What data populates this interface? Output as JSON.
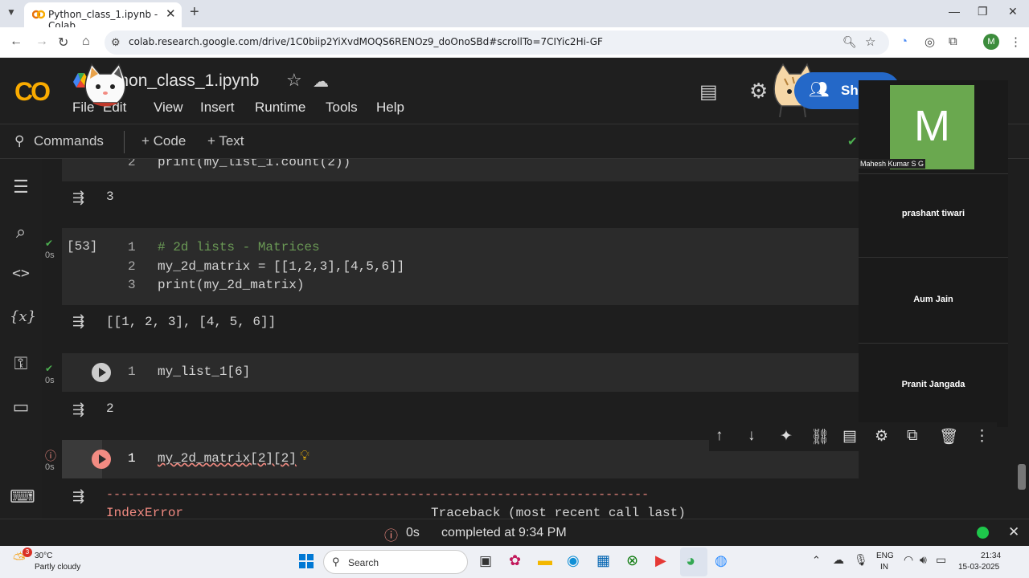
{
  "browser": {
    "tab_title": "Python_class_1.ipynb - Colab",
    "url": "colab.research.google.com/drive/1C0biip2YiXvdMOQS6RENOz9_doOnoSBd#scrollTo=7CIYic2Hi-GF",
    "profile_initial": "M"
  },
  "colab": {
    "logo": "CO",
    "notebook_title": "Python_class_1.ipynb",
    "menu": [
      "File",
      "Edit",
      "View",
      "Insert",
      "Runtime",
      "Tools",
      "Help"
    ],
    "share_label": "Sh",
    "commands_label": "Commands",
    "add_code_label": "+ Code",
    "add_text_label": "+ Text"
  },
  "cells": {
    "c1": {
      "line_no": "2",
      "code": "print(my_list_1.count(2))",
      "output": "3"
    },
    "c2": {
      "exec_count": "[53]",
      "status_time": "0s",
      "lines": [
        {
          "no": "1",
          "code": "# 2d lists - Matrices"
        },
        {
          "no": "2",
          "code": "my_2d_matrix = [[1,2,3],[4,5,6]]"
        },
        {
          "no": "3",
          "code": "print(my_2d_matrix)"
        }
      ],
      "output": "[[1, 2, 3], [4, 5, 6]]"
    },
    "c3": {
      "status_time": "0s",
      "line_no": "1",
      "code": "my_list_1[6]",
      "output": "2"
    },
    "c4": {
      "status_time": "0s",
      "line_no": "1",
      "code": "my_2d_matrix[2][2]",
      "dashes": "---------------------------------------------------------------------------",
      "error_name": "IndexError",
      "traceback": "Traceback (most recent call last)"
    }
  },
  "video_panel": {
    "tile_initial": "M",
    "tile_name": "Mahesh Kumar S G",
    "participants": [
      "prashant tiwari",
      "Aum Jain",
      "Pranit Jangada"
    ]
  },
  "status_bar": {
    "duration": "0s",
    "completed": "completed at 9:34 PM"
  },
  "taskbar": {
    "weather_temp": "30°C",
    "weather_desc": "Partly cloudy",
    "weather_badge": "3",
    "search_label": "Search",
    "lang_1": "ENG",
    "lang_2": "IN",
    "time": "21:34",
    "date": "15-03-2025"
  },
  "colors": {
    "accent_orange": "#f9ab00",
    "share_blue": "#2468c8",
    "check_green": "#4caf50",
    "error_red": "#f28b82",
    "tile_green": "#6aa84f"
  }
}
